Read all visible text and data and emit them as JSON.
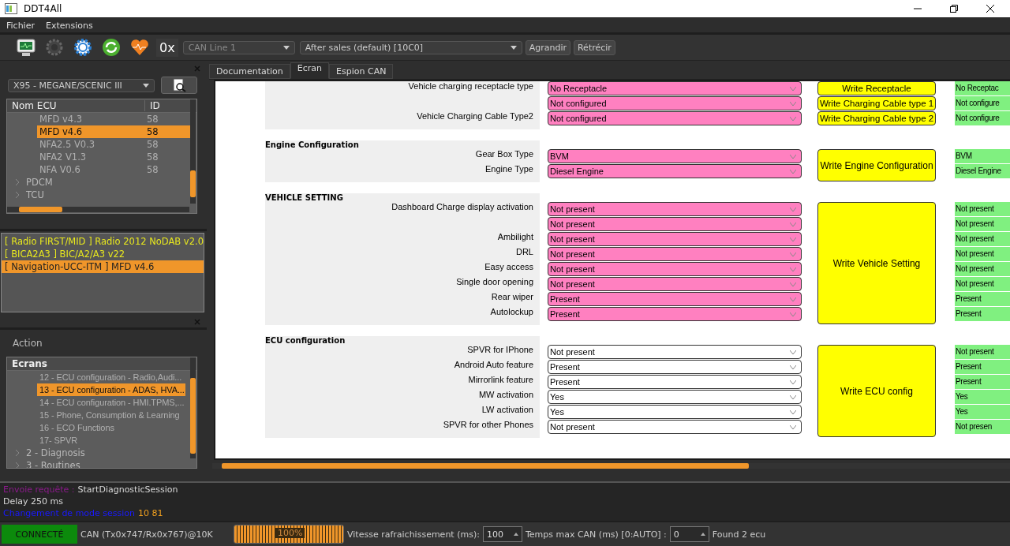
{
  "window": {
    "title": "DDT4All"
  },
  "menu": [
    "Fichier",
    "Extensions"
  ],
  "toolbar": {
    "hex_label": "0x",
    "can_line": {
      "placeholder": "CAN Line 1",
      "disabled": true
    },
    "session": {
      "value": "After sales (default) [10C0]"
    },
    "buttons": [
      "Agrandir",
      "Rétrécir"
    ]
  },
  "vehicle_select": {
    "value": "X95 - MEGANE/SCENIC III"
  },
  "ecu_tree": {
    "columns": [
      "Nom ECU",
      "ID"
    ],
    "items": [
      {
        "children": [
          {
            "name": "MFD v4.3",
            "id": "58",
            "selected": false
          },
          {
            "name": "MFD v4.6",
            "id": "58",
            "selected": true
          },
          {
            "name": "NFA2.5 V0.3",
            "id": "58",
            "selected": false
          },
          {
            "name": "NFA2 V1.3",
            "id": "58",
            "selected": false
          },
          {
            "name": "NFA V0.6",
            "id": "58",
            "selected": false
          }
        ]
      },
      {
        "name": "PDCM",
        "expanded": false
      },
      {
        "name": "TCU",
        "expanded": false
      }
    ]
  },
  "ecu_list": [
    {
      "label": "[ Radio FIRST/MID ] Radio 2012 NoDAB v2.0",
      "selected": false
    },
    {
      "label": "[ BICA2A3 ] BIC/A2/A3 v22",
      "selected": false
    },
    {
      "label": "[ Navigation-UCC-ITM ] MFD v4.6",
      "selected": true
    }
  ],
  "action": {
    "title": "Action",
    "tree_header": "Ecrans",
    "items": [
      {
        "children": [
          {
            "name": "12 - ECU configuration - Radio,Audi...",
            "selected": false
          },
          {
            "name": "13 - ECU configuration - ADAS, HVA...",
            "selected": true
          },
          {
            "name": "14 - ECU configuration - HMI.TPMS,...",
            "selected": false
          },
          {
            "name": "15 - Phone, Consumption & Learning",
            "selected": false
          },
          {
            "name": "16 - ECO Functions",
            "selected": false
          },
          {
            "name": "17- SPVR",
            "selected": false
          }
        ]
      },
      {
        "name": "2 - Diagnosis",
        "expanded": false
      },
      {
        "name": "3 - Routines",
        "expanded": false
      }
    ]
  },
  "tabs": [
    {
      "label": "Documentation",
      "selected": false
    },
    {
      "label": "Ecran",
      "selected": true
    },
    {
      "label": "Espion CAN",
      "selected": false
    }
  ],
  "sections": [
    {
      "kind": "per_row",
      "rows": [
        {
          "label": "Vehicle charging receptacle type",
          "value": "No Receptacle",
          "highlight": true,
          "button": "Write Receptacle",
          "read": "No Receptac"
        },
        {
          "value": "Not configured",
          "highlight": true,
          "button": "Write Charging Cable type 1",
          "read": "Not configure"
        },
        {
          "label": "Vehicle Charging Cable Type2",
          "value": "Not configured",
          "highlight": true,
          "button": "Write Charging Cable type 2",
          "read": "Not configure"
        }
      ]
    },
    {
      "kind": "grouped",
      "title": "Engine Configuration",
      "button": "Write Engine Configuration",
      "rows": [
        {
          "label": "Gear Box Type",
          "value": "BVM",
          "highlight": true,
          "read": "BVM"
        },
        {
          "label": "Engine Type",
          "value": "Diesel Engine",
          "highlight": true,
          "read": "Diesel Engine"
        }
      ]
    },
    {
      "kind": "grouped",
      "title": "VEHICLE SETTING",
      "button": "Write Vehicle Setting",
      "rows": [
        {
          "label": "Dashboard Charge display activation",
          "value": "Not present",
          "highlight": true,
          "read": "Not present"
        },
        {
          "value": "Not present",
          "highlight": true,
          "read": "Not present"
        },
        {
          "label": "Ambilight",
          "value": "Not present",
          "highlight": true,
          "read": "Not present"
        },
        {
          "label": "DRL",
          "value": "Not present",
          "highlight": true,
          "read": "Not present"
        },
        {
          "label": "Easy access",
          "value": "Not present",
          "highlight": true,
          "read": "Not present"
        },
        {
          "label": "Single door opening",
          "value": "Not present",
          "highlight": true,
          "read": "Not present"
        },
        {
          "label": "Rear wiper",
          "value": "Present",
          "highlight": true,
          "read": "Present"
        },
        {
          "label": "Autolockup",
          "value": "Present",
          "highlight": true,
          "read": "Present"
        }
      ]
    },
    {
      "kind": "grouped",
      "title": "ECU configuration",
      "button": "Write ECU config",
      "rows": [
        {
          "label": "SPVR for IPhone",
          "value": "Not present",
          "highlight": false,
          "read": "Not present"
        },
        {
          "label": "Android Auto feature",
          "value": "Present",
          "highlight": false,
          "read": "Present"
        },
        {
          "label": "Mirrorlink feature",
          "value": "Present",
          "highlight": false,
          "read": "Present"
        },
        {
          "label": "MW activation",
          "value": "Yes",
          "highlight": false,
          "read": "Yes"
        },
        {
          "label": "LW activation",
          "value": "Yes",
          "highlight": false,
          "read": "Yes"
        },
        {
          "label": "SPVR for other Phones",
          "value": "Not present",
          "highlight": false,
          "read": "Not presen"
        }
      ]
    }
  ],
  "log": [
    [
      {
        "text": "Envoie requête :",
        "color": "#8a1a8a"
      },
      {
        "text": "StartDiagnosticSession",
        "color": "#d8d8d8"
      }
    ],
    [
      {
        "text": "Delay 250 ms",
        "color": "#d8d8d8"
      }
    ],
    [
      {
        "text": "Changement de mode session",
        "color": "#1a1aff"
      },
      {
        "text": "10 81",
        "color": "#f0a020"
      }
    ]
  ],
  "status_bar": {
    "connection": {
      "label": "CONNECTÉ",
      "connected": true
    },
    "can_info": "CAN (Tx0x747/Rx0x767)@10K",
    "progress": {
      "level": 1,
      "reading": "100%"
    },
    "refresh_label": "Vitesse rafraichissement (ms):",
    "refresh_value": "100",
    "timeout_label": "Temps max CAN (ms) [0:AUTO] :",
    "timeout_value": "0",
    "found": "Found 2 ecu"
  }
}
